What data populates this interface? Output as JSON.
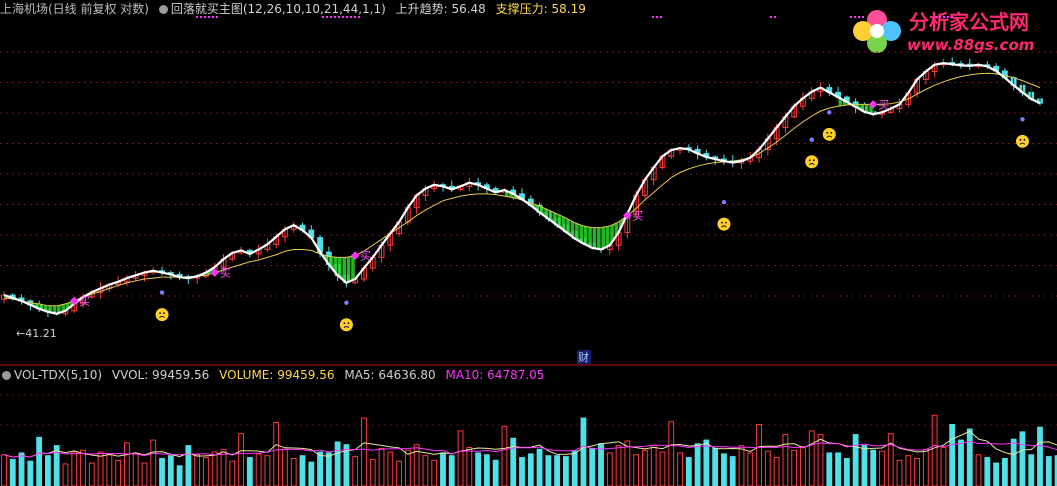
{
  "header": {
    "stock": "上海机场(日线 前复权 对数)",
    "indicator": "回落就买主图(12,26,10,10,21,44,1,1)",
    "trend_label": "上升趋势: 56.48",
    "support_label": "支撑压力: 58.19"
  },
  "vol_header": {
    "name": "VOL-TDX(5,10)",
    "vvol": "VVOL: 99459.56",
    "volume": "VOLUME: 99459.56",
    "ma5": "MA5: 64636.80",
    "ma10": "MA10: 64787.05"
  },
  "logo": {
    "text": "分析家公式网",
    "url": "www.88gs.com"
  },
  "chart_data": [
    {
      "type": "candlestick",
      "low_label": "←41.21",
      "buy_label": "买",
      "fin_label": "财",
      "close": [
        43.5,
        43.2,
        42.9,
        42.5,
        42.1,
        41.8,
        41.6,
        41.9,
        42.6,
        43.3,
        43.8,
        44.2,
        44.6,
        44.9,
        45.3,
        45.6,
        45.9,
        46.1,
        45.9,
        45.7,
        45.4,
        45.3,
        45.5,
        45.9,
        46.5,
        47.4,
        48.1,
        48.4,
        48.0,
        48.5,
        49.1,
        50.0,
        50.9,
        51.4,
        50.8,
        49.9,
        48.2,
        46.8,
        45.6,
        44.8,
        45.2,
        46.4,
        47.6,
        49.0,
        50.4,
        51.8,
        53.6,
        55.2,
        56.1,
        56.6,
        56.4,
        56.0,
        56.4,
        56.9,
        56.6,
        56.1,
        55.6,
        55.9,
        55.4,
        54.7,
        53.9,
        53.0,
        52.2,
        51.4,
        50.6,
        49.8,
        49.2,
        48.7,
        48.5,
        49.0,
        50.5,
        52.8,
        55.2,
        57.3,
        59.0,
        60.6,
        61.5,
        61.8,
        61.6,
        61.0,
        60.5,
        60.2,
        59.9,
        59.7,
        59.9,
        60.4,
        61.6,
        63.2,
        64.9,
        66.6,
        68.3,
        69.6,
        70.7,
        71.4,
        70.6,
        69.8,
        69.0,
        68.2,
        67.4,
        67.0,
        67.3,
        67.9,
        68.6,
        70.5,
        72.8,
        74.2,
        75.4,
        75.7,
        75.5,
        75.3,
        75.2,
        75.4,
        75.1,
        74.3,
        73.1,
        71.8,
        70.6,
        69.5,
        68.8
      ],
      "ma_slow": [
        43.2,
        43.1,
        42.9,
        42.7,
        42.6,
        42.4,
        42.4,
        42.6,
        42.9,
        43.3,
        43.6,
        43.9,
        44.2,
        44.5,
        44.8,
        45.0,
        45.2,
        45.3,
        45.4,
        45.4,
        45.4,
        45.4,
        45.5,
        45.6,
        45.9,
        46.2,
        46.5,
        46.8,
        47.1,
        47.3,
        47.6,
        47.9,
        48.3,
        48.5,
        48.5,
        48.4,
        48.0,
        47.7,
        47.6,
        47.6,
        47.8,
        48.3,
        49.0,
        49.7,
        50.4,
        51.1,
        51.8,
        52.6,
        53.3,
        53.9,
        54.5,
        54.8,
        55.1,
        55.3,
        55.4,
        55.4,
        55.3,
        55.1,
        54.9,
        54.6,
        54.2,
        53.8,
        53.3,
        52.8,
        52.3,
        51.7,
        51.3,
        51.1,
        51.1,
        51.3,
        51.8,
        52.6,
        53.5,
        54.6,
        55.6,
        56.6,
        57.6,
        58.3,
        58.8,
        59.2,
        59.5,
        59.7,
        59.8,
        59.9,
        60.1,
        60.4,
        61.0,
        61.8,
        62.7,
        63.7,
        64.8,
        65.8,
        66.7,
        67.5,
        68.0,
        68.3,
        68.5,
        68.6,
        68.6,
        68.6,
        68.6,
        68.7,
        69.0,
        69.5,
        70.3,
        71.1,
        71.8,
        72.4,
        72.9,
        73.3,
        73.6,
        73.8,
        73.9,
        73.8,
        73.5,
        73.1,
        72.6,
        72.0,
        71.4
      ],
      "green_ranges": [
        [
          0,
          8
        ],
        [
          21,
          24
        ],
        [
          36,
          40
        ],
        [
          57,
          71
        ],
        [
          95,
          99
        ],
        [
          113,
          120
        ]
      ],
      "buy_markers": [
        8,
        24,
        40,
        71,
        99
      ],
      "face_markers": [
        [
          18,
          -3.0
        ],
        [
          39,
          -3.0
        ],
        [
          82,
          -4.5
        ],
        [
          92,
          -5.0
        ],
        [
          94,
          -3.0
        ],
        [
          116,
          -3.5
        ]
      ],
      "ylim": [
        40.5,
        80
      ]
    },
    {
      "type": "bar",
      "name": "VOL-TDX",
      "volume": [
        34,
        29,
        36,
        27,
        53,
        33,
        44,
        24,
        37,
        39,
        25,
        37,
        34,
        28,
        47,
        35,
        25,
        50,
        30,
        33,
        22,
        44,
        34,
        31,
        37,
        40,
        27,
        57,
        31,
        35,
        33,
        69,
        40,
        30,
        33,
        26,
        37,
        36,
        48,
        45,
        32,
        74,
        29,
        41,
        37,
        27,
        39,
        45,
        33,
        28,
        36,
        33,
        60,
        42,
        36,
        34,
        28,
        65,
        52,
        31,
        35,
        40,
        33,
        33,
        32,
        38,
        74,
        41,
        46,
        36,
        44,
        49,
        34,
        39,
        44,
        37,
        70,
        36,
        31,
        46,
        50,
        41,
        35,
        32,
        44,
        36,
        67,
        38,
        31,
        56,
        39,
        43,
        60,
        56,
        36,
        36,
        30,
        56,
        44,
        39,
        38,
        57,
        28,
        33,
        30,
        40,
        77,
        42,
        67,
        50,
        62,
        34,
        31,
        25,
        30,
        51,
        59,
        34,
        64,
        32,
        33,
        40,
        29,
        40
      ],
      "ylim": [
        0,
        110
      ]
    }
  ]
}
